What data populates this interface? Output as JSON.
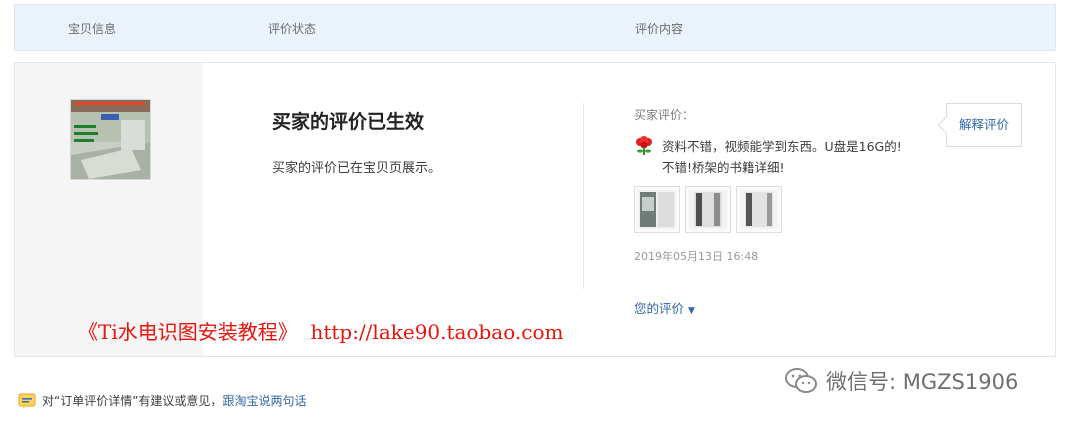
{
  "header": {
    "col_item": "宝贝信息",
    "col_status": "评价状态",
    "col_content": "评价内容"
  },
  "status": {
    "title": "买家的评价已生效",
    "description": "买家的评价已在宝贝页展示。"
  },
  "review": {
    "buyer_label": "买家评价：",
    "text": "资料不错，视频能学到东西。U盘是16G的!不错!桥架的书籍详细!",
    "timestamp": "2019年05月13日 16:48",
    "your_review_label": "您的评价",
    "explain_button": "解释评价",
    "photo_count": 3
  },
  "watermark": {
    "red_text": "《Ti水电识图安装教程》  http://lake90.taobao.com",
    "wechat_text": "微信号: MGZS1906"
  },
  "feedback": {
    "prefix": "对“订单评价详情”有建议或意见，",
    "link": "跟淘宝说两句话"
  },
  "colors": {
    "link": "#3366aa",
    "header_bg": "#eaf2fb",
    "watermark_red": "#e8140a"
  }
}
